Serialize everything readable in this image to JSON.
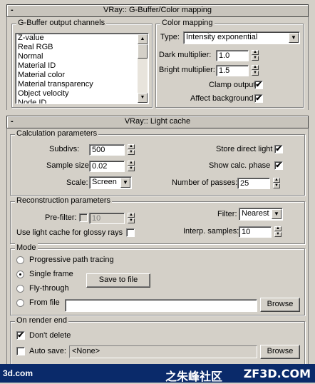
{
  "gbuffer": {
    "rollout_title": "VRay:: G-Buffer/Color mapping",
    "output_channels_title": "G-Buffer output channels",
    "channels": [
      "Z-value",
      "Real RGB",
      "Normal",
      "Material ID",
      "Material color",
      "Material transparency",
      "Object velocity",
      "Node ID"
    ],
    "color_mapping_title": "Color mapping",
    "type_label": "Type:",
    "type_value": "Intensity exponential",
    "dark_multiplier_label": "Dark multiplier:",
    "dark_multiplier_value": "1.0",
    "bright_multiplier_label": "Bright multiplier:",
    "bright_multiplier_value": "1.5",
    "clamp_output_label": "Clamp output",
    "clamp_output_checked": true,
    "affect_background_label": "Affect background",
    "affect_background_checked": true
  },
  "lightcache": {
    "rollout_title": "VRay:: Light cache",
    "calc_title": "Calculation parameters",
    "subdivs_label": "Subdivs:",
    "subdivs_value": "500",
    "sample_size_label": "Sample size:",
    "sample_size_value": "0.02",
    "scale_label": "Scale:",
    "scale_value": "Screen",
    "store_direct_light_label": "Store direct light",
    "store_direct_light_checked": true,
    "show_calc_phase_label": "Show calc. phase",
    "show_calc_phase_checked": true,
    "num_passes_label": "Number of passes:",
    "num_passes_value": "25",
    "recon_title": "Reconstruction parameters",
    "prefilter_label": "Pre-filter:",
    "prefilter_value": "10",
    "glossy_label": "Use light cache for glossy rays",
    "filter_label": "Filter:",
    "filter_value": "Nearest",
    "interp_label": "Interp. samples:",
    "interp_value": "10",
    "mode_title": "Mode",
    "mode_options": [
      "Progressive path tracing",
      "Single frame",
      "Fly-through",
      "From file"
    ],
    "mode_selected_index": 1,
    "save_to_file_label": "Save to file",
    "browse_label": "Browse",
    "on_render_end_title": "On render end",
    "dont_delete_label": "Don't delete",
    "dont_delete_checked": true,
    "auto_save_label": "Auto save:",
    "auto_save_value": "<None>",
    "browse2_label": "Browse"
  },
  "watermark": {
    "left": "3d.com",
    "mid": "之朱峰社区",
    "right": "ZF3D.COM"
  }
}
